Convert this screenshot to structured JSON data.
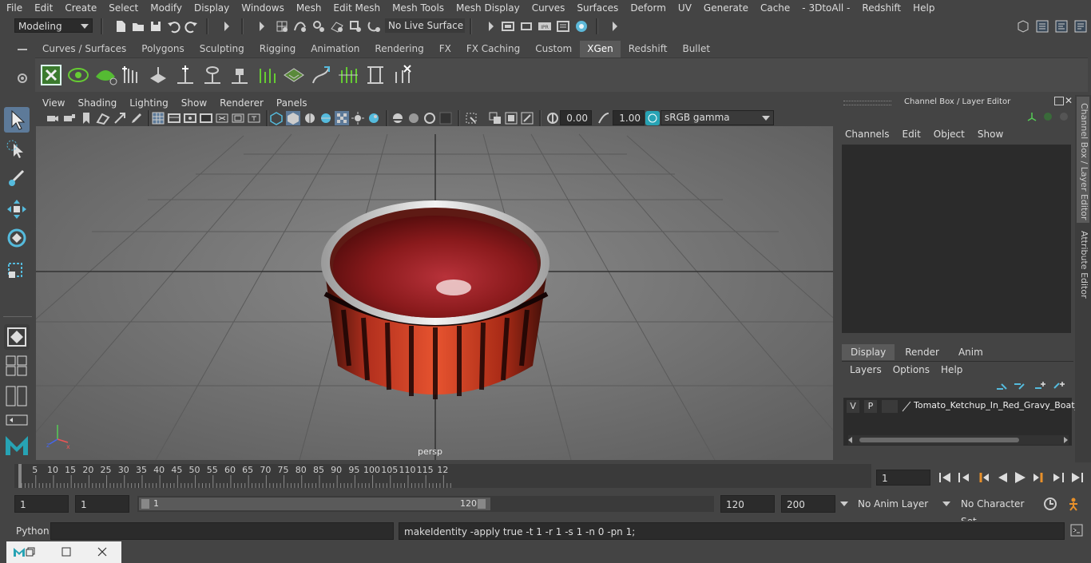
{
  "menubar": [
    "File",
    "Edit",
    "Create",
    "Select",
    "Modify",
    "Display",
    "Windows",
    "Mesh",
    "Edit Mesh",
    "Mesh Tools",
    "Mesh Display",
    "Curves",
    "Surfaces",
    "Deform",
    "UV",
    "Generate",
    "Cache",
    "- 3DtoAll -",
    "Redshift",
    "Help"
  ],
  "status": {
    "mode": "Modeling",
    "live_surface": "No Live Surface"
  },
  "shelf": {
    "tabs": [
      "Curves / Surfaces",
      "Polygons",
      "Sculpting",
      "Rigging",
      "Animation",
      "Rendering",
      "FX",
      "FX Caching",
      "Custom",
      "XGen",
      "Redshift",
      "Bullet"
    ],
    "active": "XGen"
  },
  "viewport": {
    "menu": [
      "View",
      "Shading",
      "Lighting",
      "Show",
      "Renderer",
      "Panels"
    ],
    "exposure": "0.00",
    "gamma": "1.00",
    "colorspace": "sRGB gamma",
    "camera": "persp"
  },
  "right_panel": {
    "title": "Channel Box / Layer Editor",
    "channel_menu": [
      "Channels",
      "Edit",
      "Object",
      "Show"
    ],
    "layer_tabs": [
      "Display",
      "Render",
      "Anim"
    ],
    "layer_tab_active": "Display",
    "layer_menu": [
      "Layers",
      "Options",
      "Help"
    ],
    "layer": {
      "v": "V",
      "p": "P",
      "name": "Tomato_Ketchup_In_Red_Gravy_Boat_"
    },
    "side_tabs": [
      "Channel Box / Layer Editor",
      "Attribute Editor"
    ]
  },
  "timeline": {
    "ticks": [
      "5",
      "10",
      "15",
      "20",
      "25",
      "30",
      "35",
      "40",
      "45",
      "50",
      "55",
      "60",
      "65",
      "70",
      "75",
      "80",
      "85",
      "90",
      "95",
      "100",
      "105",
      "110",
      "115",
      "12"
    ],
    "start_marker": "1",
    "current_frame": "1"
  },
  "range": {
    "start": "1",
    "inner_start": "1",
    "slider_start": "1",
    "slider_end": "120",
    "end": "120",
    "max_end": "200",
    "anim_layer": "No Anim Layer",
    "char_set": "No Character Set"
  },
  "cmd": {
    "lang": "Python",
    "output": "makeIdentity -apply true -t 1 -r 1 -s 1 -n 0 -pn 1;"
  }
}
